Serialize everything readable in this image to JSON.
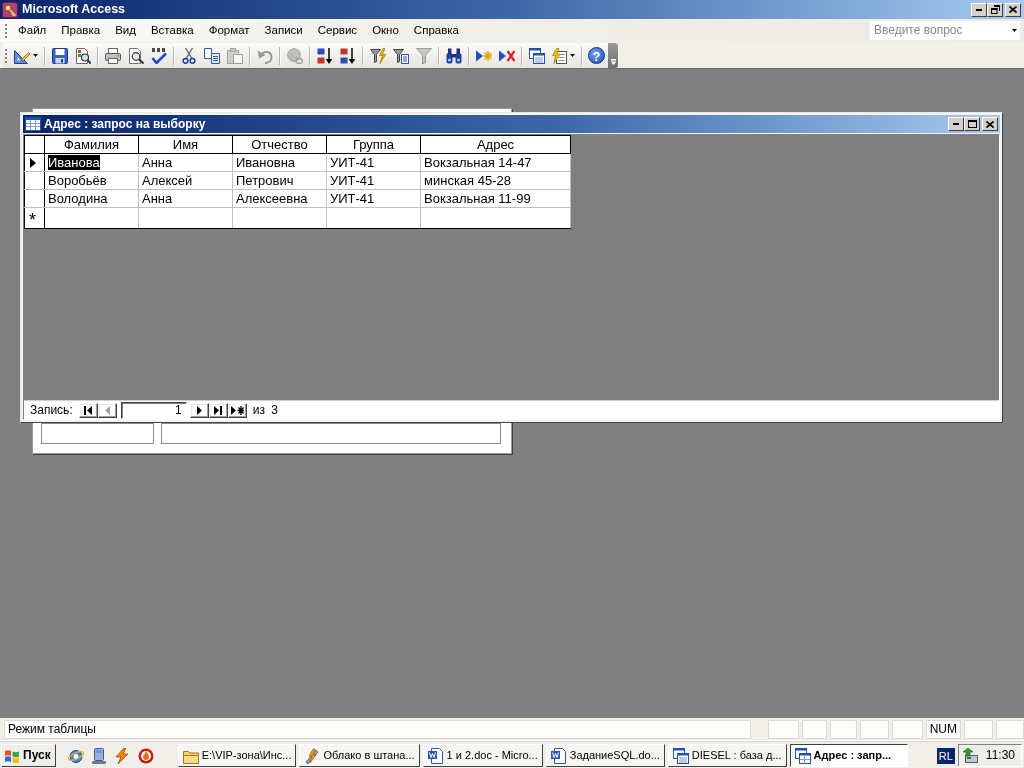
{
  "app": {
    "title": "Microsoft Access"
  },
  "menu": [
    "Файл",
    "Правка",
    "Вид",
    "Вставка",
    "Формат",
    "Записи",
    "Сервис",
    "Окно",
    "Справка"
  ],
  "help_box": {
    "placeholder": "Введите вопрос"
  },
  "toolbar": [
    [
      {
        "kind": "view",
        "disabled": false,
        "dropdown": true
      }
    ],
    [
      {
        "kind": "save",
        "disabled": false,
        "dropdown": false
      },
      {
        "kind": "file-search",
        "disabled": false,
        "dropdown": false
      }
    ],
    [
      {
        "kind": "print",
        "disabled": false,
        "dropdown": false
      },
      {
        "kind": "preview",
        "disabled": false,
        "dropdown": false
      },
      {
        "kind": "spelling",
        "disabled": false,
        "dropdown": false
      }
    ],
    [
      {
        "kind": "cut",
        "disabled": false,
        "dropdown": false
      },
      {
        "kind": "copy",
        "disabled": false,
        "dropdown": false
      },
      {
        "kind": "paste",
        "disabled": true,
        "dropdown": false
      }
    ],
    [
      {
        "kind": "undo",
        "disabled": true,
        "dropdown": false
      }
    ],
    [
      {
        "kind": "hyperlink",
        "disabled": true,
        "dropdown": false
      }
    ],
    [
      {
        "kind": "sort-asc",
        "disabled": false,
        "dropdown": false
      },
      {
        "kind": "sort-desc",
        "disabled": false,
        "dropdown": false
      }
    ],
    [
      {
        "kind": "filter-selection",
        "disabled": false,
        "dropdown": false
      },
      {
        "kind": "filter-form",
        "disabled": false,
        "dropdown": false
      },
      {
        "kind": "apply-filter",
        "disabled": true,
        "dropdown": false
      }
    ],
    [
      {
        "kind": "find",
        "disabled": false,
        "dropdown": false
      }
    ],
    [
      {
        "kind": "new-record",
        "disabled": false,
        "dropdown": false
      },
      {
        "kind": "delete-record",
        "disabled": false,
        "dropdown": false
      }
    ],
    [
      {
        "kind": "database-window",
        "disabled": false,
        "dropdown": false
      },
      {
        "kind": "new-object",
        "disabled": false,
        "dropdown": true
      }
    ],
    [
      {
        "kind": "help",
        "disabled": false,
        "dropdown": false,
        "glyph": "?"
      }
    ]
  ],
  "query_window": {
    "title": "Адрес : запрос на выборку",
    "columns": [
      "Фамилия",
      "Имя",
      "Отчество",
      "Группа",
      "Адрес"
    ],
    "rows": [
      {
        "selected": true,
        "cells": [
          {
            "text": "Иванова",
            "highlighted": true
          },
          {
            "text": "Анна",
            "highlighted": false
          },
          {
            "text": "Ивановна",
            "highlighted": false
          },
          {
            "text": "УИТ-41",
            "highlighted": false
          },
          {
            "text": "Вокзальная 14-47",
            "highlighted": false
          }
        ]
      },
      {
        "selected": false,
        "cells": [
          {
            "text": "Воробьёв",
            "highlighted": false
          },
          {
            "text": "Алексей",
            "highlighted": false
          },
          {
            "text": "Петрович",
            "highlighted": false
          },
          {
            "text": "УИТ-41",
            "highlighted": false
          },
          {
            "text": "минская 45-28",
            "highlighted": false
          }
        ]
      },
      {
        "selected": false,
        "cells": [
          {
            "text": "Володина",
            "highlighted": false
          },
          {
            "text": "Анна",
            "highlighted": false
          },
          {
            "text": "Алексеевна",
            "highlighted": false
          },
          {
            "text": "УИТ-41",
            "highlighted": false
          },
          {
            "text": "Вокзальная 11-99",
            "highlighted": false
          }
        ]
      }
    ],
    "new_row_marker": "*",
    "navigator": {
      "label": "Запись:",
      "current": "1",
      "total": "из 3",
      "buttons": [
        {
          "kind": "first",
          "disabled": false
        },
        {
          "kind": "prev",
          "disabled": true
        },
        {
          "kind": "next",
          "disabled": false
        },
        {
          "kind": "last",
          "disabled": false
        },
        {
          "kind": "new",
          "disabled": false
        }
      ]
    }
  },
  "status_bar": {
    "text": "Режим таблицы",
    "indicator": "NUM"
  },
  "taskbar": {
    "start": "Пуск",
    "tasks": [
      {
        "kind": "folder",
        "title": "E:\\VIP-зона\\Инс...",
        "selected": false
      },
      {
        "kind": "player",
        "title": "Облако в штана...",
        "selected": false
      },
      {
        "kind": "word",
        "title": "1 и 2.doc - Micro...",
        "selected": false
      },
      {
        "kind": "word",
        "title": "ЗаданиеSQL.do...",
        "selected": false
      },
      {
        "kind": "database",
        "title": "DIESEL : база д...",
        "selected": false
      },
      {
        "kind": "query",
        "title": "Адрес : запр...",
        "selected": true
      }
    ],
    "language": "RL",
    "clock": "11:30"
  }
}
